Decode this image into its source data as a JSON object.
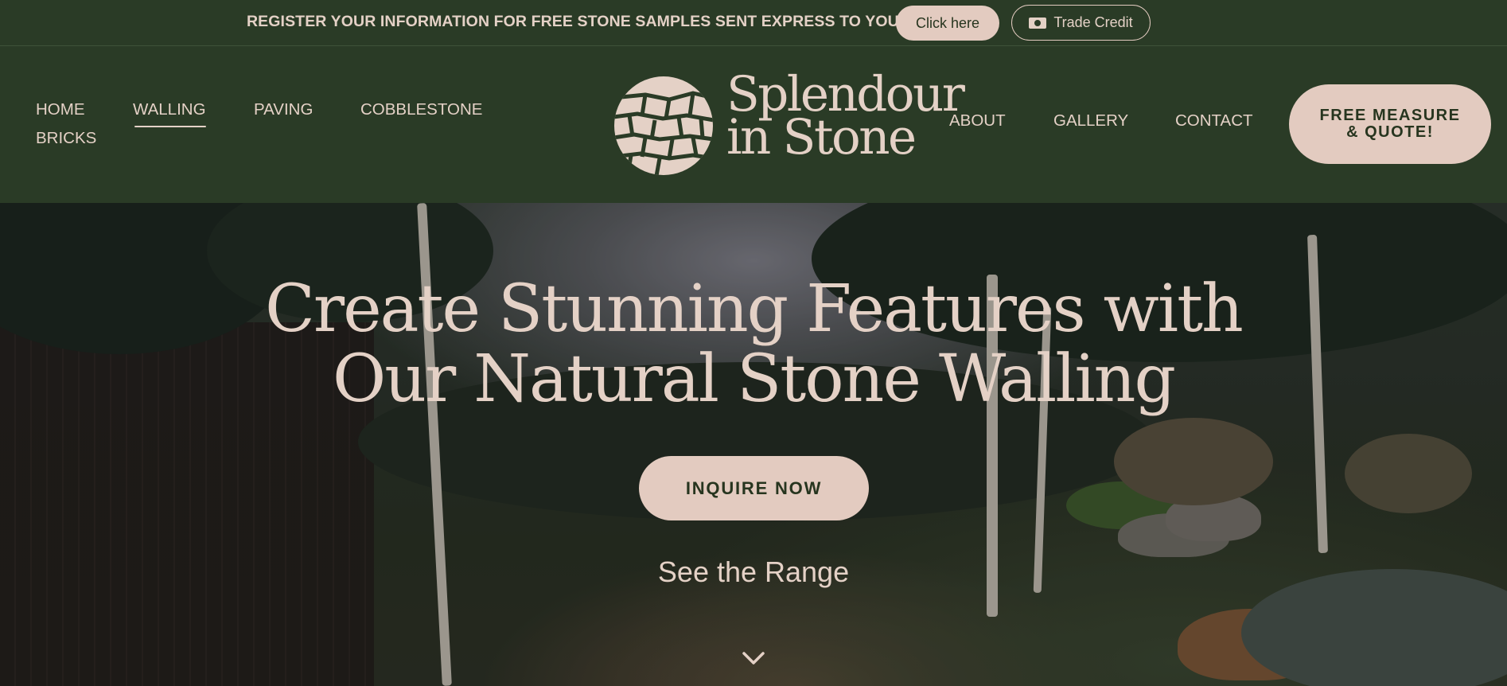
{
  "topbar": {
    "message": "REGISTER YOUR INFORMATION FOR FREE STONE SAMPLES SENT EXPRESS TO YOU!",
    "click_label": "Click here",
    "trade_label": "Trade Credit",
    "trade_icon": "cash-icon"
  },
  "nav": {
    "left": [
      "HOME",
      "WALLING",
      "PAVING",
      "COBBLESTONE",
      "BRICKS"
    ],
    "active": "WALLING",
    "right": [
      "ABOUT",
      "GALLERY",
      "CONTACT"
    ],
    "quote_button": "FREE MEASURE & QUOTE!"
  },
  "logo": {
    "line1": "Splendour",
    "line2": "in Stone",
    "icon": "stone-wall-logo-icon"
  },
  "hero": {
    "title_line1": "Create Stunning Features with",
    "title_line2": "Our Natural Stone Walling",
    "cta": "INQUIRE NOW",
    "range_link": "See the Range",
    "scroll_icon": "chevron-down-icon"
  },
  "colors": {
    "brand_green": "#2a3b26",
    "accent_pink": "#e3cbc0",
    "text_light": "#e4d1c6",
    "text_dark": "#27351f"
  }
}
